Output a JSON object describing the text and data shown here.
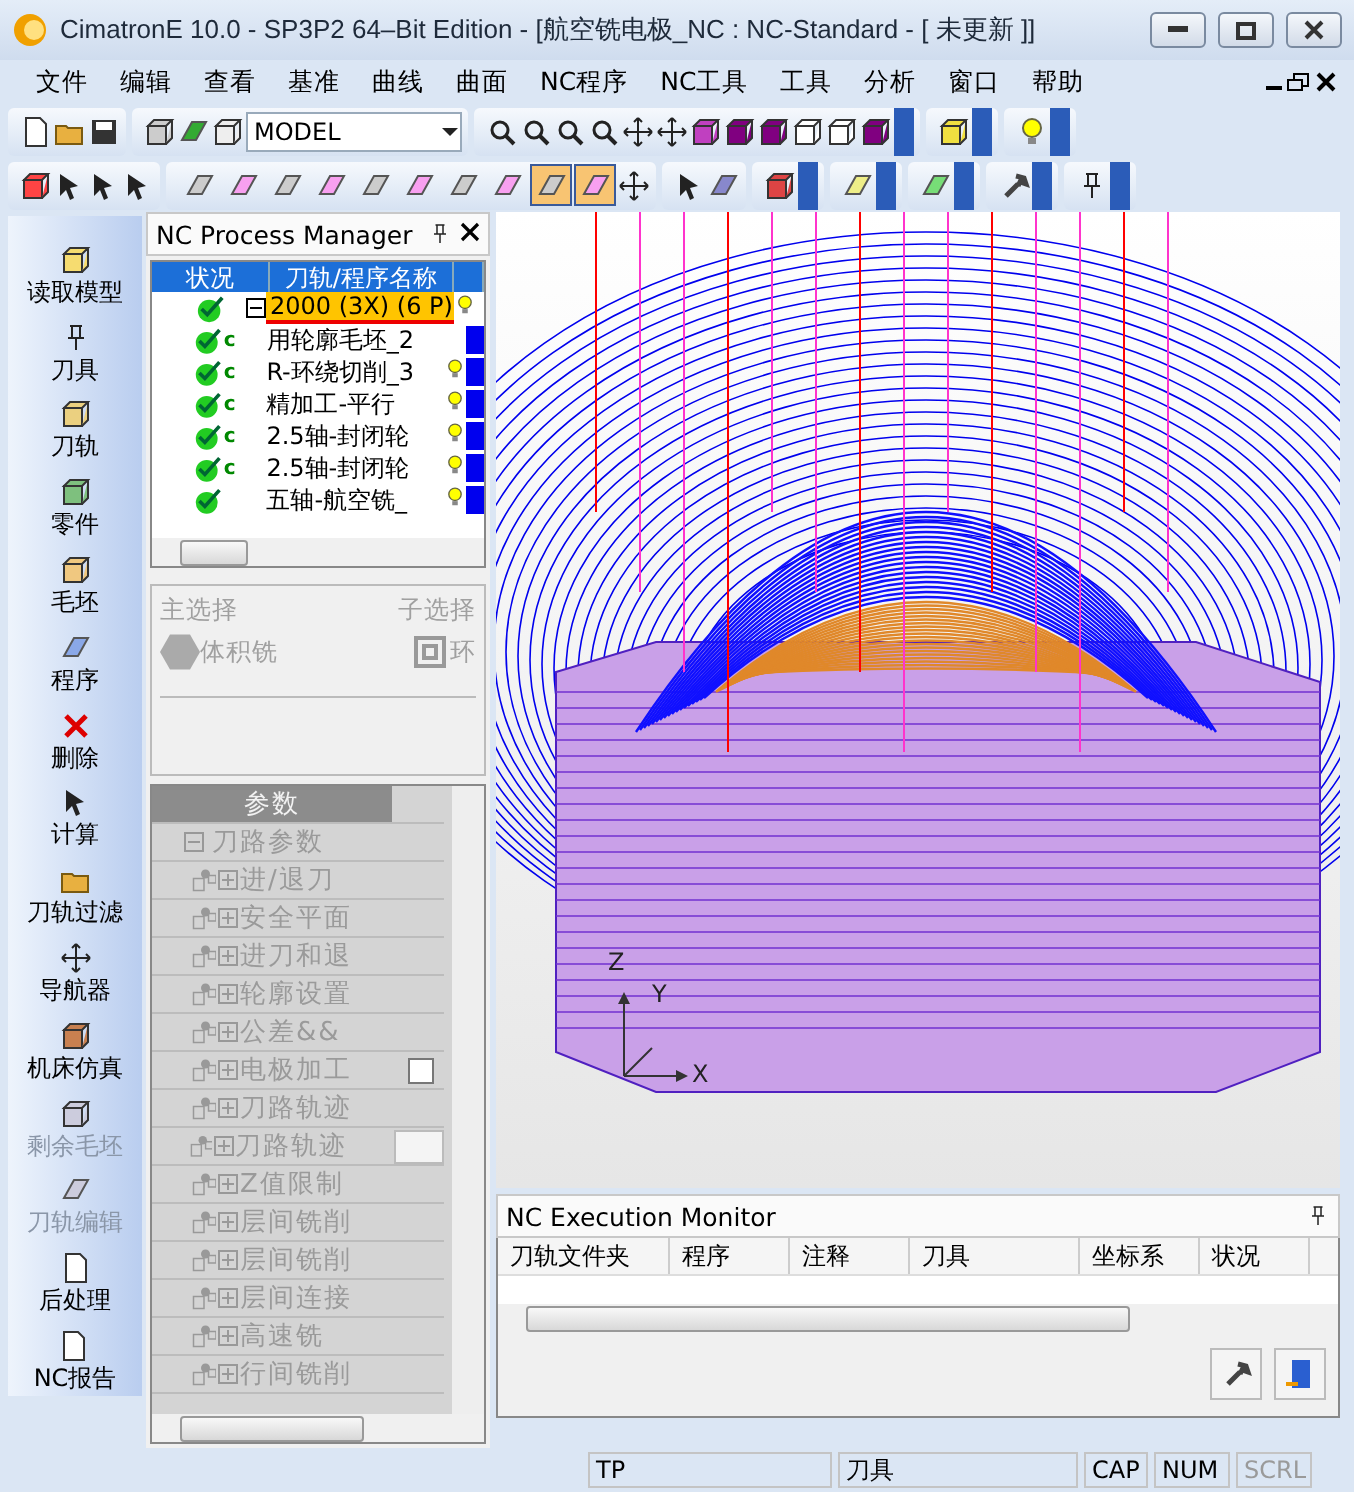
{
  "window": {
    "title": "CimatronE 10.0 - SP3P2 64–Bit Edition - [航空铣电极_NC : NC-Standard - [ 未更新 ]]"
  },
  "menu": [
    "文件",
    "编辑",
    "查看",
    "基准",
    "曲线",
    "曲面",
    "NC程序",
    "NC工具",
    "工具",
    "分析",
    "窗口",
    "帮助"
  ],
  "toolbar": {
    "view_combo": "MODEL",
    "filter_buttons": [
      {
        "pressed": false
      },
      {
        "pressed": false
      },
      {
        "pressed": false
      },
      {
        "pressed": false
      },
      {
        "pressed": false
      },
      {
        "pressed": false
      },
      {
        "pressed": false
      },
      {
        "pressed": false
      },
      {
        "pressed": true
      },
      {
        "pressed": true
      }
    ]
  },
  "sidebar": {
    "items": [
      {
        "label": "读取模型",
        "disabled": false
      },
      {
        "label": "刀具",
        "disabled": false
      },
      {
        "label": "刀轨",
        "disabled": false
      },
      {
        "label": "零件",
        "disabled": false
      },
      {
        "label": "毛坯",
        "disabled": false
      },
      {
        "label": "程序",
        "disabled": false
      },
      {
        "label": "删除",
        "disabled": false
      },
      {
        "label": "计算",
        "disabled": false
      },
      {
        "label": "刀轨过滤",
        "disabled": false
      },
      {
        "label": "导航器",
        "disabled": false
      },
      {
        "label": "机床仿真",
        "disabled": false
      },
      {
        "label": "剩余毛坯",
        "disabled": true
      },
      {
        "label": "刀轨编辑",
        "disabled": true
      },
      {
        "label": "后处理",
        "disabled": false
      },
      {
        "label": "NC报告",
        "disabled": false
      }
    ]
  },
  "nc_manager": {
    "title": "NC Process Manager",
    "columns": [
      "状况",
      "刀轨/程序名称"
    ],
    "rows": [
      {
        "name": "2000 (3X) (6 P)",
        "selected": true,
        "expanded": true,
        "mark": "",
        "bulb": true,
        "blue": false
      },
      {
        "name": "用轮廓毛坯_2",
        "selected": false,
        "mark": "c",
        "bulb": false,
        "blue": true
      },
      {
        "name": "R-环绕切削_3",
        "selected": false,
        "mark": "c",
        "bulb": true,
        "blue": true
      },
      {
        "name": "精加工-平行",
        "selected": false,
        "mark": "c",
        "bulb": true,
        "blue": true
      },
      {
        "name": "2.5轴-封闭轮",
        "selected": false,
        "mark": "c",
        "bulb": true,
        "blue": true
      },
      {
        "name": "2.5轴-封闭轮",
        "selected": false,
        "mark": "c",
        "bulb": true,
        "blue": true
      },
      {
        "name": "五轴-航空铣_",
        "selected": false,
        "mark": "",
        "bulb": true,
        "blue": true
      }
    ]
  },
  "selection": {
    "main_label": "主选择",
    "main_value": "体积铣",
    "sub_label": "子选择",
    "sub_value": "环"
  },
  "params": {
    "header": "参数",
    "root": {
      "label": "刀路参数",
      "expanded": true,
      "children": [
        {
          "label": "进/退刀",
          "kind": "plain"
        },
        {
          "label": "安全平面",
          "kind": "plain"
        },
        {
          "label": "进刀和退",
          "kind": "plain"
        },
        {
          "label": "轮廓设置",
          "kind": "plain"
        },
        {
          "label": "公差&&",
          "kind": "plain"
        },
        {
          "label": "电极加工",
          "kind": "checkbox",
          "checked": false
        },
        {
          "label": "刀路轨迹",
          "kind": "plain"
        },
        {
          "label": "刀路轨迹",
          "kind": "field"
        },
        {
          "label": "Z值限制",
          "kind": "plain"
        },
        {
          "label": "层间铣削",
          "kind": "plain"
        },
        {
          "label": "层间铣削",
          "kind": "plain"
        },
        {
          "label": "层间连接",
          "kind": "plain"
        },
        {
          "label": "高速铣",
          "kind": "plain"
        },
        {
          "label": "行间铣削",
          "kind": "plain"
        }
      ]
    }
  },
  "viewport": {
    "axes": [
      "Z",
      "Y",
      "X"
    ]
  },
  "monitor": {
    "title": "NC Execution Monitor",
    "columns": [
      "刀轨文件夹",
      "程序",
      "注释",
      "刀具",
      "坐标系",
      "状况"
    ]
  },
  "status_bar": [
    {
      "text": "TP",
      "disabled": false
    },
    {
      "text": "刀具",
      "disabled": false
    },
    {
      "text": "CAP",
      "disabled": false
    },
    {
      "text": "NUM",
      "disabled": false
    },
    {
      "text": "SCRL",
      "disabled": true
    }
  ]
}
